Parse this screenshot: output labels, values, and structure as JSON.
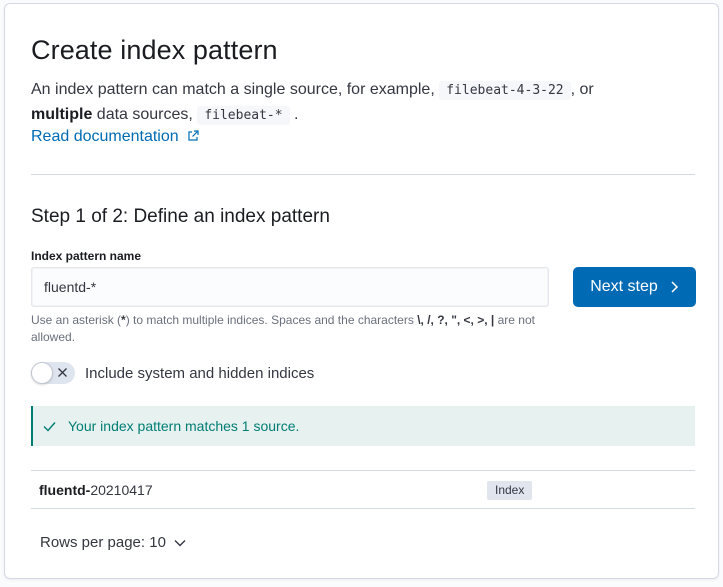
{
  "header": {
    "title": "Create index pattern",
    "desc_prefix": "An index pattern can match a single source, for example,",
    "example_single": "filebeat-4-3-22",
    "desc_or": ", or",
    "desc_multiple": "multiple",
    "desc_middle": "data sources,",
    "example_multiple": "filebeat-*",
    "desc_end": ".",
    "doc_link": "Read documentation",
    "doc_link_icon": "external-link-icon"
  },
  "step": {
    "title": "Step 1 of 2: Define an index pattern",
    "field_label": "Index pattern name",
    "input_value": "fluentd-*",
    "input_placeholder": "",
    "next_button": "Next step",
    "next_icon": "chevron-right-icon",
    "help_prefix": "Use an asterisk (",
    "help_asterisk": "*",
    "help_middle": ") to match multiple indices. Spaces and the characters",
    "help_chars": "\\, /, ?, \", <, >, |",
    "help_suffix": "are not allowed.",
    "toggle_label": "Include system and hidden indices",
    "toggle_on": false
  },
  "callout": {
    "text": "Your index pattern matches 1 source.",
    "icon": "check-icon",
    "color": "#017d73"
  },
  "table": {
    "rows": [
      {
        "name_bold": "fluentd-",
        "name_rest": "20210417",
        "badge": "Index"
      }
    ]
  },
  "pagination": {
    "rows_per_page": "Rows per page: 10",
    "icon": "chevron-down-icon"
  },
  "colors": {
    "primary": "#006bb4",
    "success": "#017d73",
    "border": "#d3dae6"
  }
}
